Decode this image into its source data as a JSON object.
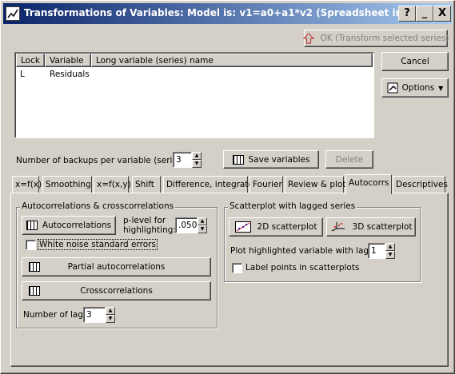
{
  "window": {
    "title": "Transformations of Variables: Model is: v1=a0+a1*v2 (Spreadsheet in Ivanov",
    "help_label": "?",
    "min_label": "_",
    "close_label": "X"
  },
  "buttons": {
    "ok": "OK (Transform selected series)",
    "cancel": "Cancel",
    "options": "Options",
    "save_variables": "Save variables",
    "delete": "Delete"
  },
  "list": {
    "columns": [
      "Lock",
      "Variable",
      "Long variable (series) name"
    ],
    "rows": [
      {
        "lock": "L",
        "variable": "Residuals",
        "long_name": ""
      }
    ]
  },
  "backups": {
    "label": "Number of backups per variable (series):",
    "value": "3"
  },
  "tabs": [
    "x=f(x)",
    "Smoothing",
    "x=f(x,y)",
    "Shift",
    "Difference, integrate",
    "Fourier",
    "Review & plot",
    "Autocorrs",
    "Descriptives"
  ],
  "active_tab": "Autocorrs",
  "autocorr_group": {
    "title": "Autocorrelations & crosscorrelations",
    "autocorrelations_button": "Autocorrelations",
    "plevel_label_1": "p-level for",
    "plevel_label_2": "highlighting:",
    "plevel_value": ".050",
    "white_noise_label": "White noise standard errors",
    "white_noise_checked": false,
    "partial_button": "Partial autocorrelations",
    "cross_button": "Crosscorrelations",
    "lags_label": "Number of lags:",
    "lags_value": "3"
  },
  "scatter_group": {
    "title": "Scatterplot with lagged series",
    "scatter2d_button": "2D scatterplot",
    "scatter3d_button": "3D scatterplot",
    "lag_label": "Plot highlighted variable with lag of:",
    "lag_value": "1",
    "label_points": "Label points in scatterplots",
    "label_points_checked": false
  },
  "colors": {
    "title_start": "#0a246a",
    "title_end": "#a6caf0",
    "face": "#d4d0c8",
    "selection": "#000080"
  }
}
